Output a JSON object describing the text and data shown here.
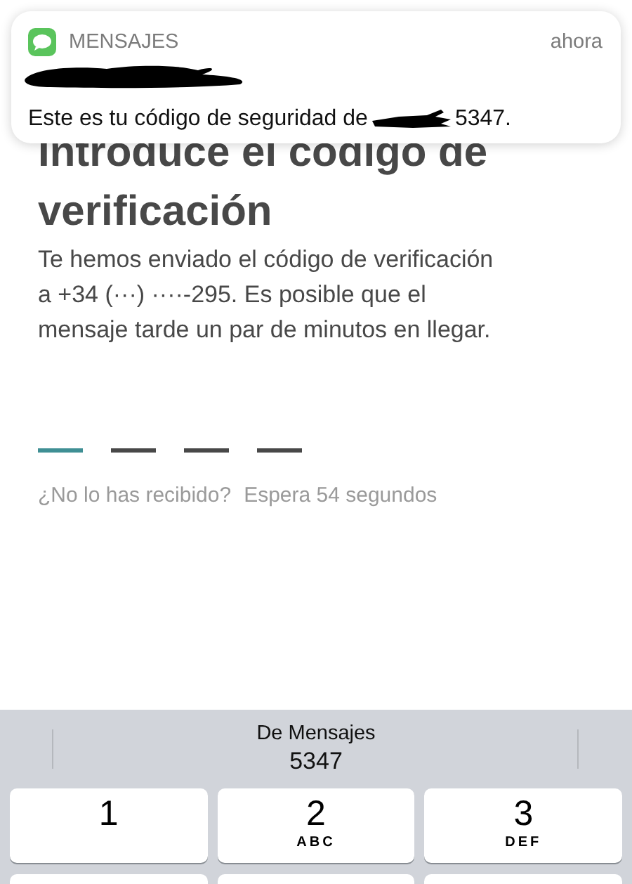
{
  "notification": {
    "app": "MENSAJES",
    "time": "ahora",
    "message": "Este es tu código de seguridad de",
    "code": "5347."
  },
  "heading": "Introduce el código de verificación",
  "description": "Te hemos enviado el código de verificación a +34 (···) ····-295. Es posible que el mensaje tarde un par de minutos en llegar.",
  "code_slots": [
    {
      "selected": true
    },
    {
      "selected": false
    },
    {
      "selected": false
    },
    {
      "selected": false
    }
  ],
  "hint": {
    "question": "¿No lo has recibido?",
    "wait": "Espera 54 segundos"
  },
  "keyboard": {
    "suggestion": {
      "source": "De Mensajes",
      "code": "5347"
    },
    "keys": [
      {
        "digit": "1"
      },
      {
        "digit": "2",
        "letters": "ABC"
      },
      {
        "digit": "3",
        "letters": "DEF"
      }
    ],
    "next_row": [
      {
        "kind": "blank"
      },
      {
        "kind": "blank"
      },
      {
        "kind": "blank"
      }
    ]
  }
}
